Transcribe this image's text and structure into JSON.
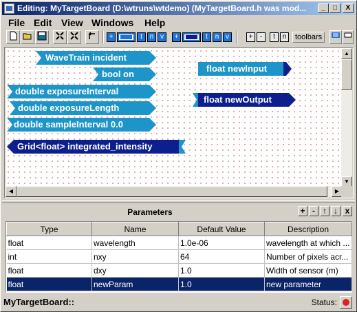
{
  "window": {
    "title": "Editing:  MyTargetBoard  (D:\\wtruns\\wtdemo)  (MyTargetBoard.h was mod...",
    "minimize": "_",
    "maximize": "□",
    "close": "X"
  },
  "menu": {
    "file": "File",
    "edit": "Edit",
    "view": "View",
    "windows": "Windows",
    "help": "Help"
  },
  "toolbar": {
    "plus": "+",
    "t": "t",
    "n": "n",
    "v": "v",
    "minus": "-",
    "toolbars": "toolbars"
  },
  "canvas": {
    "inputs": [
      {
        "label": "WaveTrain incident"
      },
      {
        "label": "bool on"
      },
      {
        "label": "double exposureInterval"
      },
      {
        "label": "double exposureLength"
      },
      {
        "label": "double sampleInterval 0.0"
      }
    ],
    "outputs_left": [
      {
        "label": "Grid<float> integrated_intensity"
      }
    ],
    "board_inputs": [
      {
        "label": "float newInput"
      }
    ],
    "board_outputs": [
      {
        "label": "float newOutput"
      }
    ],
    "colors": {
      "input": "#1e95c8",
      "output": "#0c1f8c"
    }
  },
  "params": {
    "title": "Parameters",
    "buttons": {
      "add": "+",
      "remove": "-",
      "up": "↑",
      "down": "↓",
      "close": "x"
    },
    "columns": [
      "Type",
      "Name",
      "Default Value",
      "Description"
    ],
    "rows": [
      {
        "type": "float",
        "name": "wavelength",
        "default": "1.0e-06",
        "description": "wavelength at which ..."
      },
      {
        "type": "int",
        "name": "nxy",
        "default": "64",
        "description": "Number of pixels acr..."
      },
      {
        "type": "float",
        "name": "dxy",
        "default": "1.0",
        "description": "Width of sensor (m)"
      },
      {
        "type": "float",
        "name": "newParam",
        "default": "1.0",
        "description": "new parameter"
      }
    ]
  },
  "status": {
    "left": "MyTargetBoard::",
    "label": "Status:",
    "indicator_color": "#e02020"
  }
}
